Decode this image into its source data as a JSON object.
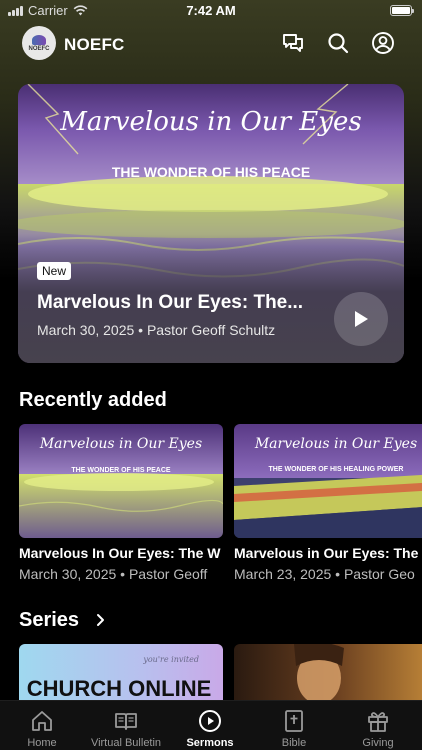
{
  "status_bar": {
    "carrier": "Carrier",
    "time": "7:42 AM"
  },
  "header": {
    "logo_text": "NOEFC",
    "title": "NOEFC"
  },
  "hero": {
    "art_title": "Marvelous in Our Eyes",
    "art_subtitle": "THE WONDER OF HIS PEACE",
    "badge": "New",
    "title": "Marvelous In Our Eyes: The...",
    "meta": "March 30, 2025 • Pastor Geoff Schultz"
  },
  "recent": {
    "section_title": "Recently added",
    "items": [
      {
        "art_title": "Marvelous in Our Eyes",
        "art_subtitle": "THE WONDER OF HIS PEACE",
        "title": "Marvelous In Our Eyes: The W",
        "meta": "March 30, 2025 • Pastor Geoff"
      },
      {
        "art_title": "Marvelous in Our Eyes",
        "art_subtitle": "THE WONDER OF HIS HEALING POWER",
        "title": "Marvelous in Our Eyes: The",
        "meta": "March 23, 2025 • Pastor Geo"
      }
    ]
  },
  "series": {
    "section_title": "Series",
    "items": [
      {
        "art_title": "CHURCH ONLINE",
        "art_tag": "you're invited"
      },
      {
        "art_title": ""
      }
    ]
  },
  "tabs": [
    {
      "label": "Home",
      "icon": "home-icon",
      "active": false
    },
    {
      "label": "Virtual Bulletin",
      "icon": "book-icon",
      "active": false
    },
    {
      "label": "Sermons",
      "icon": "play-circle-icon",
      "active": true
    },
    {
      "label": "Bible",
      "icon": "bible-icon",
      "active": false
    },
    {
      "label": "Giving",
      "icon": "gift-icon",
      "active": false
    }
  ],
  "colors": {
    "accent": "#ffffff",
    "tab_inactive": "#9a9a9a",
    "art_purple": "#7b5aa8",
    "art_yellow": "#d8e86a"
  }
}
